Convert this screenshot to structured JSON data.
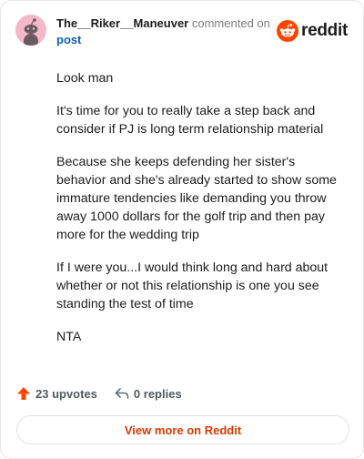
{
  "header": {
    "author": "The__Riker__Maneuver",
    "action_text": "commented on",
    "post_link": "post",
    "brand": "reddit"
  },
  "comment": {
    "paragraphs": [
      "Look man",
      "It's time for you to really take a step back and consider if PJ is long term relationship material",
      "Because she keeps defending her sister's behavior and she's already started to show some immature tendencies like demanding you throw away 1000 dollars for the golf trip and then pay more for the wedding trip",
      "If I were you...I would think long and hard about whether or not this relationship is one you see standing the test of time",
      "NTA"
    ]
  },
  "footer": {
    "upvotes": "23 upvotes",
    "replies": "0 replies",
    "view_more": "View more on Reddit"
  },
  "colors": {
    "accent": "#ff4500",
    "link": "#0a5ebb",
    "view_more_text": "#d93a00"
  },
  "icons": [
    "reddit-snoo-avatar-icon",
    "reddit-logo-icon",
    "upvote-arrow-icon",
    "reply-arrow-icon"
  ]
}
